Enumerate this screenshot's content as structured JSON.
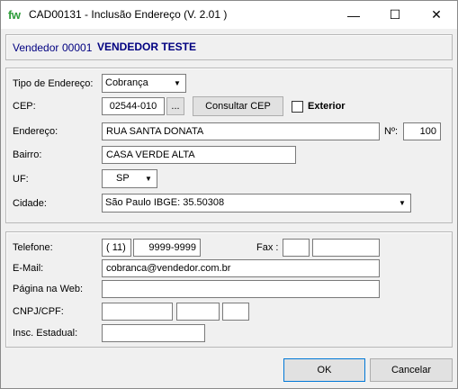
{
  "window": {
    "app_icon": "fw",
    "title": "CAD00131 - Inclusão Endereço  (V.  2.01 )",
    "minimize_glyph": "—",
    "maximize_glyph": "☐",
    "close_glyph": "✕"
  },
  "vendor": {
    "label": "Vendedor",
    "code": "00001",
    "name": "VENDEDOR TESTE"
  },
  "address": {
    "tipo_label": "Tipo de Endereço:",
    "tipo_value": "Cobrança",
    "cep_label": "CEP:",
    "cep_value": "02544-010",
    "cep_lookup_label": "...",
    "consultar_cep_label": "Consultar CEP",
    "exterior_label": "Exterior",
    "exterior_checked": false,
    "endereco_label": "Endereço:",
    "endereco_value": "RUA SANTA DONATA",
    "numero_label": "Nº:",
    "numero_value": "100",
    "bairro_label": "Bairro:",
    "bairro_value": "CASA VERDE ALTA",
    "uf_label": "UF:",
    "uf_value": "SP",
    "cidade_label": "Cidade:",
    "cidade_value": "São Paulo IBGE: 35.50308"
  },
  "contact": {
    "telefone_label": "Telefone:",
    "ddd_value": "( 11)",
    "telefone_value": "9999-9999",
    "fax_label": "Fax :",
    "fax_ddd_value": "",
    "fax_value": "",
    "email_label": "E-Mail:",
    "email_value": "cobranca@vendedor.com.br",
    "web_label": "Página na Web:",
    "web_value": "",
    "cnpj_label": "CNPJ/CPF:",
    "cnpj_part1": "",
    "cnpj_part2": "",
    "cnpj_part3": "",
    "ie_label": "Insc. Estadual:",
    "ie_value": ""
  },
  "buttons": {
    "ok_label": "OK",
    "cancel_label": "Cancelar"
  },
  "icons": {
    "app": "fw-logo-icon",
    "combo_arrow": "chevron-down-icon"
  }
}
